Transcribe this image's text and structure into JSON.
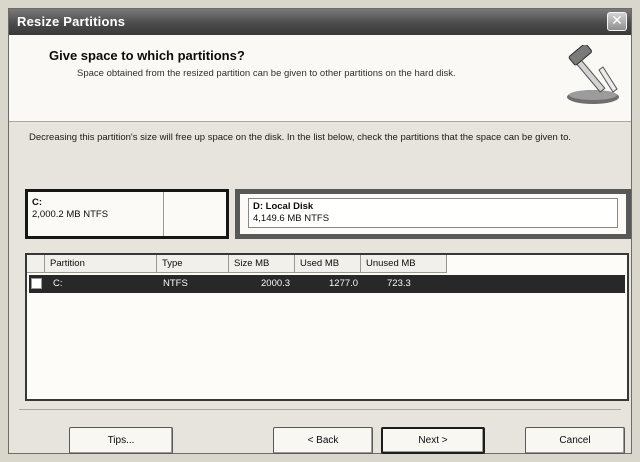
{
  "window": {
    "title": "Resize Partitions",
    "close_glyph": "✕"
  },
  "header": {
    "heading": "Give space to which partitions?",
    "subheading": "Space obtained from the resized partition can be given to other partitions on the hard disk.",
    "icon": "wizard-hammer-icon"
  },
  "instruction": "Decreasing this partition's size will free up space on the disk. In the list below, check the partitions that the space can be given to.",
  "partitions_map": {
    "c": {
      "name": "C:",
      "details": "2,000.2 MB   NTFS"
    },
    "d": {
      "name": "D:   Local Disk",
      "details": "4,149.6 MB   NTFS"
    }
  },
  "table": {
    "columns": [
      "Partition",
      "Type",
      "Size MB",
      "Used MB",
      "Unused MB"
    ],
    "rows": [
      {
        "partition": "C:",
        "type": "NTFS",
        "size": "2000.3",
        "used": "1277.0",
        "unused": "723.3",
        "checked": false
      }
    ]
  },
  "buttons": {
    "tips": "Tips...",
    "back": "< Back",
    "next": "Next >",
    "cancel": "Cancel"
  }
}
